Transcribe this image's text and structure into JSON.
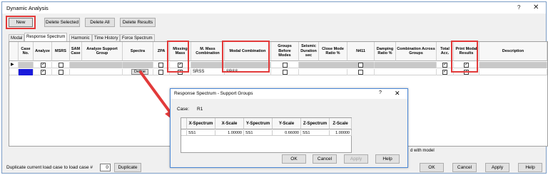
{
  "window": {
    "title": "Dynamic Analysis",
    "help_glyph": "?",
    "close_glyph": "✕"
  },
  "toolbar": {
    "new_label": "New",
    "delete_selected_label": "Delete Selected",
    "delete_all_label": "Delete All",
    "delete_results_label": "Delete Results"
  },
  "tabs": [
    "Modal",
    "Response Spectrum",
    "Harmonic",
    "Time History",
    "Force Spectrum"
  ],
  "grid": {
    "headers": [
      "Case No.",
      "Analyze",
      "MSRS",
      "SAM Case",
      "Analyze Support Group",
      "Spectra",
      "ZPA",
      "Missing Mass",
      "M. Mass Combination",
      "Modal Combination",
      "Groups Before Modes",
      "Seismic Duration sec",
      "Close Mode Ratio %",
      "N411",
      "Damping Ratio %",
      "Combination Across Groups",
      "Total Acc.",
      "Print Modal Results",
      "Description"
    ],
    "rows": [
      {
        "marker": "▶",
        "mmass_combination": "",
        "modal_combination": "",
        "check": "✓"
      },
      {
        "spectra_button": "Define",
        "mmass_combination": "SRSS",
        "modal_combination": "SRSS",
        "check": "✓"
      }
    ]
  },
  "bottom": {
    "duplicate_label": "Duplicate current load case to load case #",
    "duplicate_value": "0",
    "duplicate_button": "Duplicate",
    "partial_label": "d with model",
    "ok": "OK",
    "cancel": "Cancel",
    "apply": "Apply",
    "help": "Help"
  },
  "dialog": {
    "title": "Response Spectrum - Support Groups",
    "help_glyph": "?",
    "close_glyph": "✕",
    "case_label": "Case:",
    "case_value": "R1",
    "columns": [
      "X-Spectrum",
      "X-Scale",
      "Y-Spectrum",
      "Y-Scale",
      "Z-Spectrum",
      "Z-Scale"
    ],
    "row": [
      "SS1",
      "1.00000",
      "SS1",
      "0.66000",
      "SS1",
      "1.00000"
    ],
    "ok": "OK",
    "cancel": "Cancel",
    "apply": "Apply",
    "help": "Help"
  },
  "colors": {
    "highlight": "#e23a3a",
    "selected_cell": "#1a1adb",
    "dialog_border": "#4a87d6"
  }
}
